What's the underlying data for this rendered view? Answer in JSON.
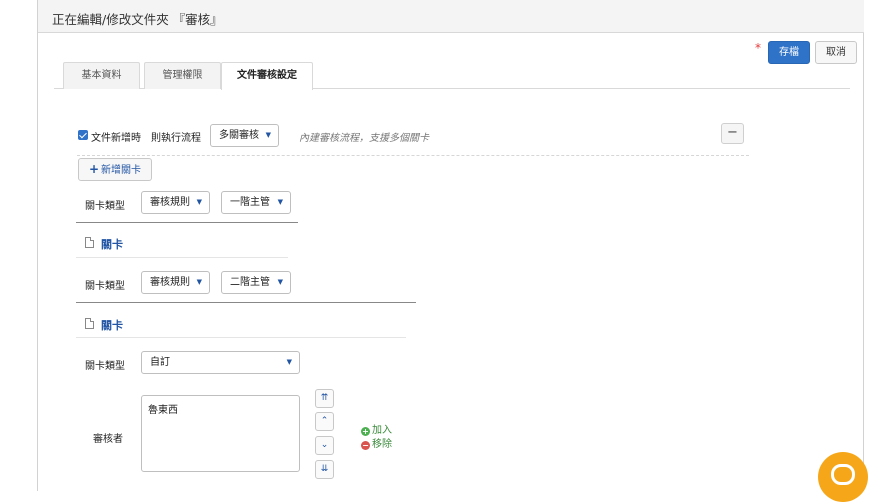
{
  "header": {
    "title": "正在編輯/修改文件夾 『審核』"
  },
  "toolbar": {
    "required_mark": "*",
    "save_label": "存檔",
    "cancel_label": "取消"
  },
  "tabs": [
    {
      "label": "基本資料",
      "active": false
    },
    {
      "label": "管理權限",
      "active": false
    },
    {
      "label": "文件審核設定",
      "active": true
    }
  ],
  "workflow": {
    "enable_label": "文件新增時",
    "run_label": "則執行流程",
    "mode_value": "多關審核",
    "hint": "內建審核流程，支援多個關卡",
    "remove_symbol": "−",
    "add_stage_label": "新增關卡"
  },
  "stages": [
    {
      "type_label": "關卡類型",
      "rule_value": "審核規則",
      "level_value": "一階主管"
    },
    {
      "title": "關卡",
      "type_label": "關卡類型",
      "rule_value": "審核規則",
      "level_value": "二階主管"
    },
    {
      "title": "關卡",
      "type_label": "關卡類型",
      "type_value": "自訂",
      "reviewer_label": "審核者",
      "reviewers": [
        "魯東西"
      ],
      "add_label": "加入",
      "remove_label": "移除"
    }
  ],
  "colors": {
    "primary": "#2f73c9",
    "link": "#2255a4",
    "add_green": "#3a8a3a",
    "remove_red": "#d9534f",
    "chat": "#f6a719"
  }
}
